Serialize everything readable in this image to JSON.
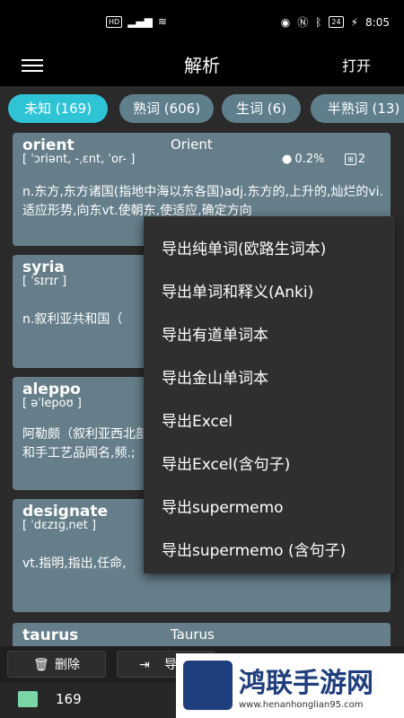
{
  "status": {
    "time": "8:05",
    "left_icons": "HD 4G wifi",
    "battery": "24"
  },
  "appbar": {
    "title": "解析",
    "open_label": "打开"
  },
  "tabs": [
    {
      "label": "未知 (169)"
    },
    {
      "label": "熟词 (606)"
    },
    {
      "label": "生词 (6)"
    },
    {
      "label": "半熟词 (13)"
    }
  ],
  "cards": [
    {
      "word": "orient",
      "orig": "Orient",
      "phon": "[ ˈɔriənt, -ˌɛnt, ˈor- ]",
      "pct": "0.2%",
      "count": "2",
      "def": "n.东方,东方诸国(指地中海以东各国)adj.东方的,上升的,灿烂的vi.适应形势,向东vt.使朝东,使适应,确定方向"
    },
    {
      "word": "syria",
      "phon": "[ ˈsɪrɪr ]",
      "def": "n.叙利亚共和国（"
    },
    {
      "word": "aleppo",
      "phon": "[ əˈlepoʊ ]",
      "def": "阿勒颇（叙利亚西北部城市）,叙利亚西北部的城市,以其独特香皂和手工艺品闻名,频.;"
    },
    {
      "word": "designate",
      "phon": "[ ˈdɛzɪɡˌnet ]",
      "def": "vt.指明,指出,任命,"
    },
    {
      "word": "taurus",
      "orig": "Taurus"
    }
  ],
  "bottom": {
    "delete_label": "删除",
    "export_label": "导出",
    "count": "169"
  },
  "menu": {
    "items": [
      "导出纯单词(欧路生词本)",
      "导出单词和释义(Anki)",
      "导出有道单词本",
      "导出金山单词本",
      "导出Excel",
      "导出Excel(含句子)",
      "导出supermemo",
      "导出supermemo (含句子)"
    ]
  },
  "watermark": {
    "title": "鸿联手游网",
    "url": "www.henanhonglian95.com"
  }
}
